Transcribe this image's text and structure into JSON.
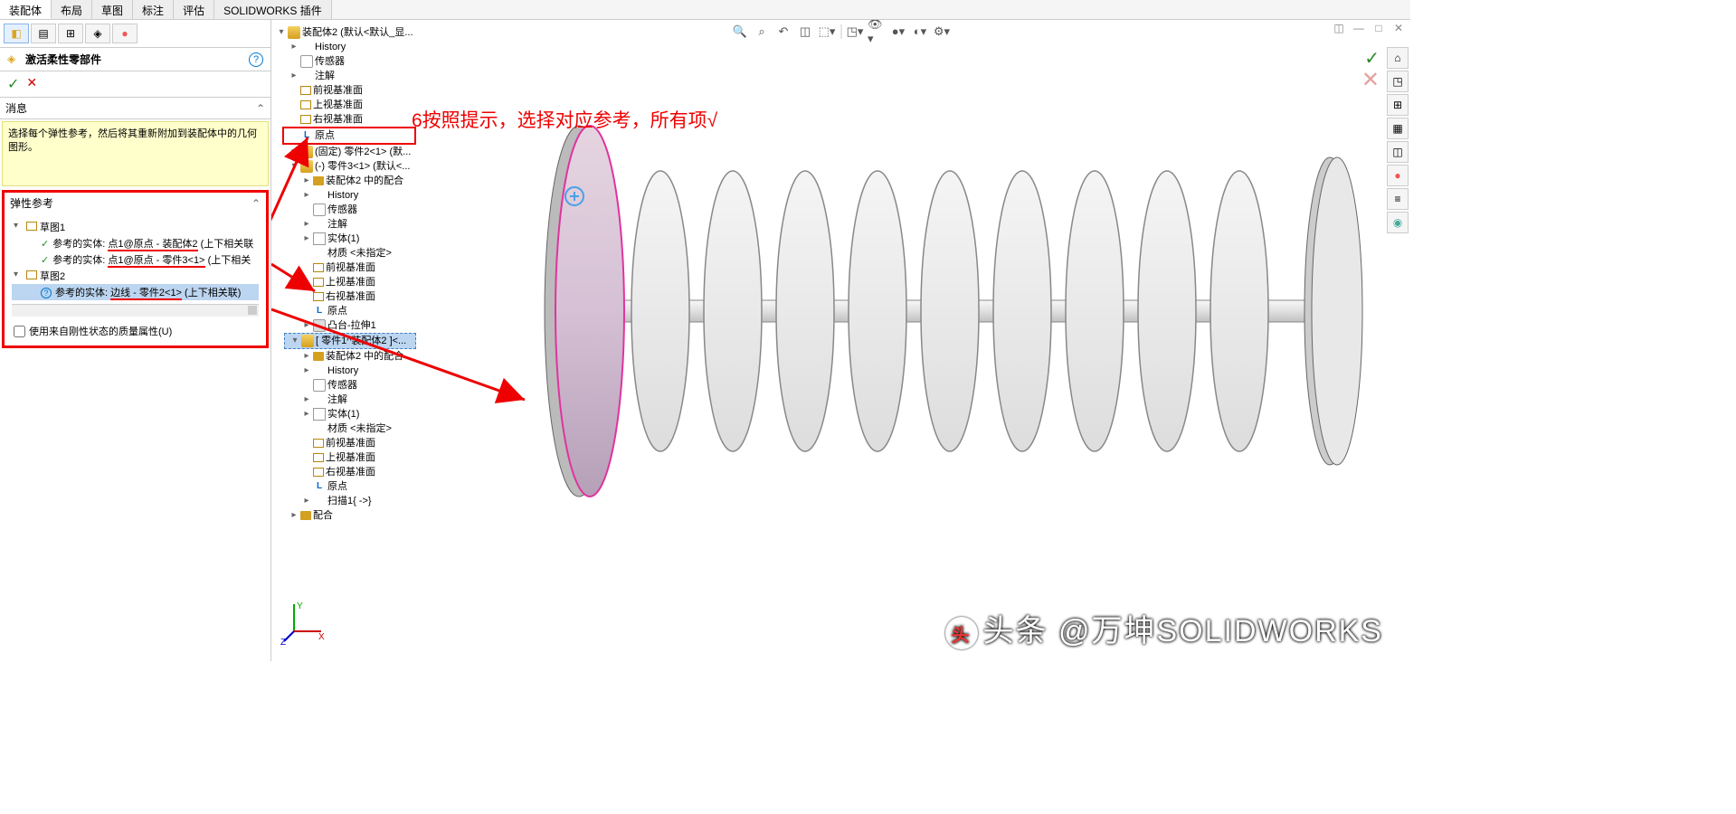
{
  "tabs": [
    "装配体",
    "布局",
    "草图",
    "标注",
    "评估",
    "SOLIDWORKS 插件"
  ],
  "activeTab": 0,
  "property": {
    "title": "激活柔性零部件",
    "ok": "✓",
    "cancel": "✕"
  },
  "msgSection": {
    "header": "消息",
    "text": "选择每个弹性参考，然后将其重新附加到装配体中的几何图形。"
  },
  "refSection": {
    "header": "弹性参考",
    "sketch1": "草图1",
    "ref1_label": "参考的实体:",
    "ref1_value": "点1@原点 - 装配体2",
    "ref1_suffix": "(上下相关联",
    "ref2_label": "参考的实体:",
    "ref2_value": "点1@原点 - 零件3<1>",
    "ref2_suffix": "(上下相关",
    "sketch2": "草图2",
    "ref3_label": "参考的实体:",
    "ref3_value": "边线 - 零件2<1>",
    "ref3_suffix": "(上下相关联)",
    "checkbox": "使用来自刚性状态的质量属性(U)"
  },
  "featureTree": {
    "root": "装配体2  (默认<默认_显...",
    "items": [
      {
        "icon": "hist",
        "label": "History",
        "indent": 1,
        "exp": "▸"
      },
      {
        "icon": "sensor",
        "label": "传感器",
        "indent": 1
      },
      {
        "icon": "anno",
        "label": "注解",
        "indent": 1,
        "exp": "▸"
      },
      {
        "icon": "plane",
        "label": "前视基准面",
        "indent": 1
      },
      {
        "icon": "plane",
        "label": "上视基准面",
        "indent": 1
      },
      {
        "icon": "plane",
        "label": "右视基准面",
        "indent": 1
      },
      {
        "icon": "origin",
        "label": "原点",
        "indent": 1,
        "box": true
      },
      {
        "icon": "part",
        "label": "(固定) 零件2<1> (默...",
        "indent": 1,
        "exp": "▸"
      },
      {
        "icon": "part",
        "label": "(-) 零件3<1>  (默认<...",
        "indent": 1,
        "exp": "▾"
      },
      {
        "icon": "folder",
        "label": "装配体2 中的配合",
        "indent": 2,
        "exp": "▸"
      },
      {
        "icon": "hist",
        "label": "History",
        "indent": 2,
        "exp": "▸"
      },
      {
        "icon": "sensor",
        "label": "传感器",
        "indent": 2
      },
      {
        "icon": "anno",
        "label": "注解",
        "indent": 2,
        "exp": "▸"
      },
      {
        "icon": "body",
        "label": "实体(1)",
        "indent": 2,
        "exp": "▸"
      },
      {
        "icon": "mat",
        "label": "材质 <未指定>",
        "indent": 2
      },
      {
        "icon": "plane",
        "label": "前视基准面",
        "indent": 2
      },
      {
        "icon": "plane",
        "label": "上视基准面",
        "indent": 2
      },
      {
        "icon": "plane",
        "label": "右视基准面",
        "indent": 2
      },
      {
        "icon": "origin",
        "label": "原点",
        "indent": 2
      },
      {
        "icon": "feat",
        "label": "凸台-拉伸1",
        "indent": 2,
        "exp": "▸"
      },
      {
        "icon": "part",
        "label": "[ 零件1^装配体2 ]<...",
        "indent": 1,
        "exp": "▾",
        "highlighted": true
      },
      {
        "icon": "folder",
        "label": "装配体2 中的配合",
        "indent": 2,
        "exp": "▸"
      },
      {
        "icon": "hist",
        "label": "History",
        "indent": 2,
        "exp": "▸"
      },
      {
        "icon": "sensor",
        "label": "传感器",
        "indent": 2
      },
      {
        "icon": "anno",
        "label": "注解",
        "indent": 2,
        "exp": "▸"
      },
      {
        "icon": "body",
        "label": "实体(1)",
        "indent": 2,
        "exp": "▸"
      },
      {
        "icon": "mat",
        "label": "材质 <未指定>",
        "indent": 2
      },
      {
        "icon": "plane",
        "label": "前视基准面",
        "indent": 2
      },
      {
        "icon": "plane",
        "label": "上视基准面",
        "indent": 2
      },
      {
        "icon": "plane",
        "label": "右视基准面",
        "indent": 2
      },
      {
        "icon": "origin",
        "label": "原点",
        "indent": 2
      },
      {
        "icon": "sweep",
        "label": "扫描1{ ->}",
        "indent": 2,
        "exp": "▸"
      },
      {
        "icon": "folder",
        "label": "配合",
        "indent": 1,
        "exp": "▸"
      }
    ]
  },
  "annotation": "6按照提示，选择对应参考，所有项√",
  "watermark": "头条 @万坤SOLIDWORKS",
  "colors": {
    "red": "#e00",
    "highlight": "#bcd5f0",
    "yellow": "#ffffcc"
  }
}
